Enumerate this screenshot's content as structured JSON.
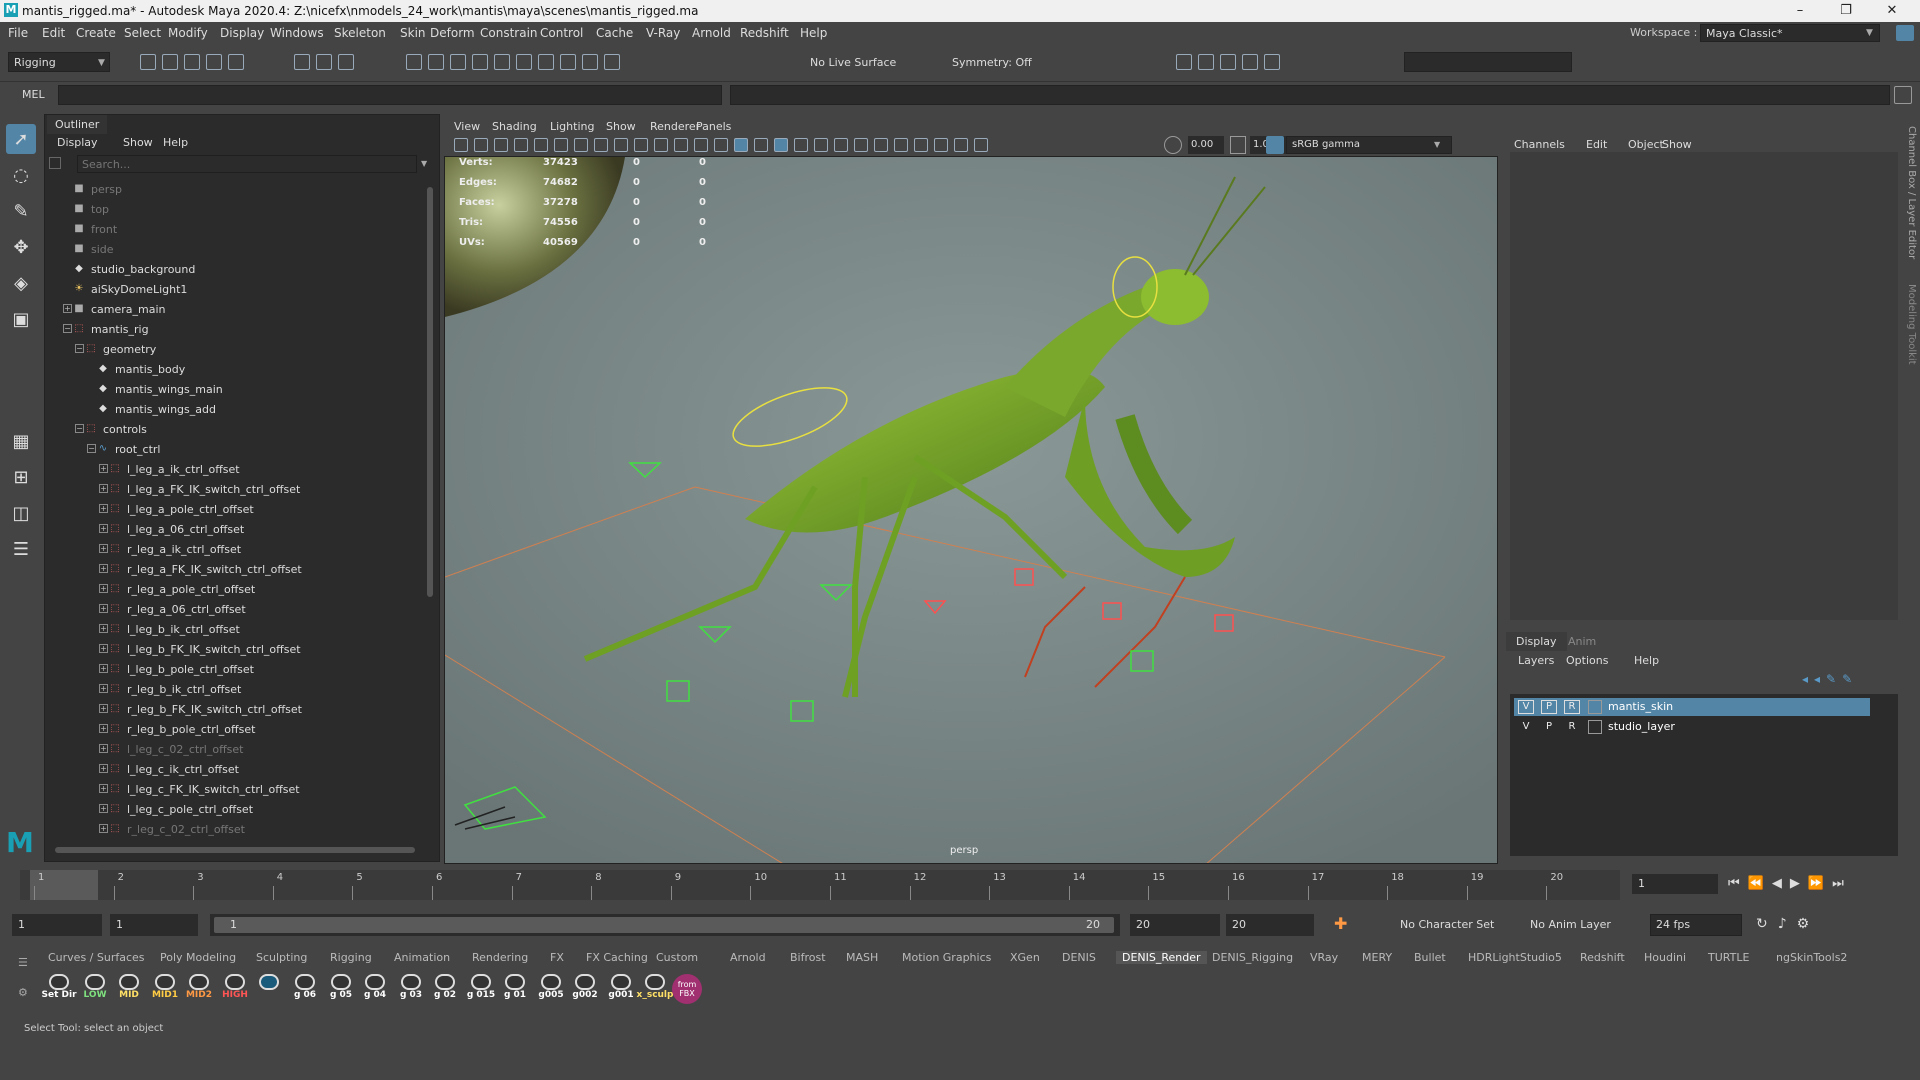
{
  "window": {
    "title": "mantis_rigged.ma* - Autodesk Maya 2020.4: Z:\\nicefx\\nmodels_24_work\\mantis\\maya\\scenes\\mantis_rigged.ma",
    "logo_letter": "M",
    "min": "–",
    "max": "❐",
    "close": "✕"
  },
  "menu": [
    "File",
    "Edit",
    "Create",
    "Select",
    "Modify",
    "Display",
    "Windows",
    "Skeleton",
    "Skin",
    "Deform",
    "Constrain",
    "Control",
    "Cache",
    "V-Ray",
    "Arnold",
    "Redshift",
    "Help"
  ],
  "workspace": {
    "label": "Workspace :",
    "value": "Maya Classic*"
  },
  "toolbar": {
    "menuset": "Rigging",
    "live_surface": "No Live Surface",
    "symmetry": "Symmetry: Off"
  },
  "cmd": {
    "label": "MEL"
  },
  "outliner": {
    "title": "Outliner",
    "menu": [
      "Display",
      "Show",
      "Help"
    ],
    "search_placeholder": "Search...",
    "rows": [
      {
        "label": "persp",
        "icon": "camera-icon",
        "indent": 0,
        "dim": true,
        "expander": ""
      },
      {
        "label": "top",
        "icon": "camera-icon",
        "indent": 0,
        "dim": true,
        "expander": ""
      },
      {
        "label": "front",
        "icon": "camera-icon",
        "indent": 0,
        "dim": true,
        "expander": ""
      },
      {
        "label": "side",
        "icon": "camera-icon",
        "indent": 0,
        "dim": true,
        "expander": ""
      },
      {
        "label": "studio_background",
        "icon": "mesh-icon",
        "indent": 0,
        "dim": false,
        "expander": ""
      },
      {
        "label": "aiSkyDomeLight1",
        "icon": "light-icon",
        "indent": 0,
        "dim": false,
        "expander": ""
      },
      {
        "label": "camera_main",
        "icon": "camera-icon",
        "indent": 0,
        "dim": false,
        "expander": "+"
      },
      {
        "label": "mantis_rig",
        "icon": "group-icon",
        "indent": 0,
        "dim": false,
        "expander": "−"
      },
      {
        "label": "geometry",
        "icon": "group-icon",
        "indent": 1,
        "dim": false,
        "expander": "−"
      },
      {
        "label": "mantis_body",
        "icon": "mesh-icon",
        "indent": 2,
        "dim": false,
        "expander": ""
      },
      {
        "label": "mantis_wings_main",
        "icon": "mesh-icon",
        "indent": 2,
        "dim": false,
        "expander": ""
      },
      {
        "label": "mantis_wings_add",
        "icon": "mesh-icon",
        "indent": 2,
        "dim": false,
        "expander": ""
      },
      {
        "label": "controls",
        "icon": "group-icon",
        "indent": 1,
        "dim": false,
        "expander": "−"
      },
      {
        "label": "root_ctrl",
        "icon": "curve-icon",
        "indent": 2,
        "dim": false,
        "expander": "−"
      },
      {
        "label": "l_leg_a_ik_ctrl_offset",
        "icon": "group-icon",
        "indent": 3,
        "dim": false,
        "expander": "+"
      },
      {
        "label": "l_leg_a_FK_IK_switch_ctrl_offset",
        "icon": "group-icon",
        "indent": 3,
        "dim": false,
        "expander": "+"
      },
      {
        "label": "l_leg_a_pole_ctrl_offset",
        "icon": "group-icon",
        "indent": 3,
        "dim": false,
        "expander": "+"
      },
      {
        "label": "l_leg_a_06_ctrl_offset",
        "icon": "group-icon",
        "indent": 3,
        "dim": false,
        "expander": "+"
      },
      {
        "label": "r_leg_a_ik_ctrl_offset",
        "icon": "group-icon",
        "indent": 3,
        "dim": false,
        "expander": "+"
      },
      {
        "label": "r_leg_a_FK_IK_switch_ctrl_offset",
        "icon": "group-icon",
        "indent": 3,
        "dim": false,
        "expander": "+"
      },
      {
        "label": "r_leg_a_pole_ctrl_offset",
        "icon": "group-icon",
        "indent": 3,
        "dim": false,
        "expander": "+"
      },
      {
        "label": "r_leg_a_06_ctrl_offset",
        "icon": "group-icon",
        "indent": 3,
        "dim": false,
        "expander": "+"
      },
      {
        "label": "l_leg_b_ik_ctrl_offset",
        "icon": "group-icon",
        "indent": 3,
        "dim": false,
        "expander": "+"
      },
      {
        "label": "l_leg_b_FK_IK_switch_ctrl_offset",
        "icon": "group-icon",
        "indent": 3,
        "dim": false,
        "expander": "+"
      },
      {
        "label": "l_leg_b_pole_ctrl_offset",
        "icon": "group-icon",
        "indent": 3,
        "dim": false,
        "expander": "+"
      },
      {
        "label": "r_leg_b_ik_ctrl_offset",
        "icon": "group-icon",
        "indent": 3,
        "dim": false,
        "expander": "+"
      },
      {
        "label": "r_leg_b_FK_IK_switch_ctrl_offset",
        "icon": "group-icon",
        "indent": 3,
        "dim": false,
        "expander": "+"
      },
      {
        "label": "r_leg_b_pole_ctrl_offset",
        "icon": "group-icon",
        "indent": 3,
        "dim": false,
        "expander": "+"
      },
      {
        "label": "l_leg_c_02_ctrl_offset",
        "icon": "group-icon",
        "indent": 3,
        "dim": true,
        "expander": "+"
      },
      {
        "label": "l_leg_c_ik_ctrl_offset",
        "icon": "group-icon",
        "indent": 3,
        "dim": false,
        "expander": "+"
      },
      {
        "label": "l_leg_c_FK_IK_switch_ctrl_offset",
        "icon": "group-icon",
        "indent": 3,
        "dim": false,
        "expander": "+"
      },
      {
        "label": "l_leg_c_pole_ctrl_offset",
        "icon": "group-icon",
        "indent": 3,
        "dim": false,
        "expander": "+"
      },
      {
        "label": "r_leg_c_02_ctrl_offset",
        "icon": "group-icon",
        "indent": 3,
        "dim": true,
        "expander": "+"
      }
    ]
  },
  "viewport": {
    "menu": [
      "View",
      "Shading",
      "Lighting",
      "Show",
      "Renderer",
      "Panels"
    ],
    "exposure": "0.00",
    "gamma": "1.00",
    "colorspace": "sRGB gamma",
    "camera_label": "persp",
    "hud": [
      {
        "label": "Verts:",
        "v1": "37423",
        "v2": "0",
        "v3": "0"
      },
      {
        "label": "Edges:",
        "v1": "74682",
        "v2": "0",
        "v3": "0"
      },
      {
        "label": "Faces:",
        "v1": "37278",
        "v2": "0",
        "v3": "0"
      },
      {
        "label": "Tris:",
        "v1": "74556",
        "v2": "0",
        "v3": "0"
      },
      {
        "label": "UVs:",
        "v1": "40569",
        "v2": "0",
        "v3": "0"
      }
    ]
  },
  "channelbox": {
    "menu": [
      "Channels",
      "Edit",
      "Object",
      "Show"
    ],
    "side_tabs": [
      "Channel Box / Layer Editor",
      "Modeling Toolkit"
    ]
  },
  "layers": {
    "tabs": [
      "Display",
      "Anim"
    ],
    "menu": [
      "Layers",
      "Options",
      "Help"
    ],
    "items": [
      {
        "v": "V",
        "p": "P",
        "r": "R",
        "name": "mantis_skin",
        "selected": true
      },
      {
        "v": "V",
        "p": "P",
        "r": "R",
        "name": "studio_layer",
        "selected": false
      }
    ]
  },
  "timeline": {
    "ticks": [
      "1",
      "2",
      "3",
      "4",
      "5",
      "6",
      "7",
      "8",
      "9",
      "10",
      "11",
      "12",
      "13",
      "14",
      "15",
      "16",
      "17",
      "18",
      "19",
      "20"
    ],
    "current_frame": "1"
  },
  "range": {
    "start": "1",
    "anim_start": "1",
    "slider_start": "1",
    "slider_end": "20",
    "anim_end": "20",
    "end": "20",
    "char_set": "No Character Set",
    "anim_layer": "No Anim Layer",
    "fps": "24 fps"
  },
  "shelf": {
    "tabs": [
      "Curves / Surfaces",
      "Poly Modeling",
      "Sculpting",
      "Rigging",
      "Animation",
      "Rendering",
      "FX",
      "FX Caching",
      "Custom",
      "Arnold",
      "Bifrost",
      "MASH",
      "Motion Graphics",
      "XGen",
      "DENIS",
      "DENIS_Render",
      "DENIS_Rigging",
      "VRay",
      "MERY",
      "Bullet",
      "HDRLightStudio5",
      "Redshift",
      "Houdini",
      "TURTLE",
      "ngSkinTools2"
    ],
    "active_tab": "DENIS_Render",
    "buttons": [
      {
        "label": "Set Dir",
        "color": "#ffffff"
      },
      {
        "label": "LOW",
        "color": "#7fe07f"
      },
      {
        "label": "MID",
        "color": "#ffe066"
      },
      {
        "label": "MID1",
        "color": "#ffcc44"
      },
      {
        "label": "MID2",
        "color": "#ff9944"
      },
      {
        "label": "HIGH",
        "color": "#ff5555"
      },
      {
        "label": "",
        "color": "#ffffff"
      },
      {
        "label": "g 06",
        "color": "#ffffff"
      },
      {
        "label": "g 05",
        "color": "#ffffff"
      },
      {
        "label": "g 04",
        "color": "#ffffff"
      },
      {
        "label": "g 03",
        "color": "#ffffff"
      },
      {
        "label": "g 02",
        "color": "#ffffff"
      },
      {
        "label": "g 015",
        "color": "#ffffff"
      },
      {
        "label": "g 01",
        "color": "#ffffff"
      },
      {
        "label": "g005",
        "color": "#ffffff"
      },
      {
        "label": "g002",
        "color": "#ffffff"
      },
      {
        "label": "g001",
        "color": "#ffffff"
      },
      {
        "label": "x_sculp",
        "color": "#ffe066"
      },
      {
        "label": "from FBX",
        "color": "#ffffff"
      }
    ]
  },
  "help": {
    "text": "Select Tool: select an object"
  },
  "colors": {
    "bg": "#444444",
    "panel": "#2b2b2b",
    "accent": "#5285a6",
    "viewport": "#7a8888",
    "grid": "#d08050"
  }
}
